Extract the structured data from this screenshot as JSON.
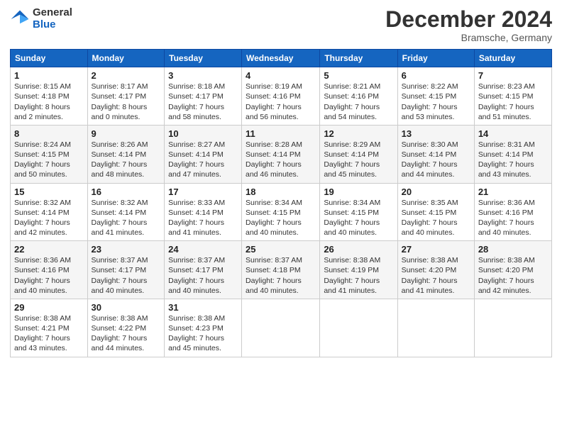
{
  "header": {
    "logo_general": "General",
    "logo_blue": "Blue",
    "main_title": "December 2024",
    "subtitle": "Bramsche, Germany"
  },
  "calendar": {
    "days_of_week": [
      "Sunday",
      "Monday",
      "Tuesday",
      "Wednesday",
      "Thursday",
      "Friday",
      "Saturday"
    ],
    "weeks": [
      [
        {
          "day": "1",
          "info": "Sunrise: 8:15 AM\nSunset: 4:18 PM\nDaylight: 8 hours\nand 2 minutes."
        },
        {
          "day": "2",
          "info": "Sunrise: 8:17 AM\nSunset: 4:17 PM\nDaylight: 8 hours\nand 0 minutes."
        },
        {
          "day": "3",
          "info": "Sunrise: 8:18 AM\nSunset: 4:17 PM\nDaylight: 7 hours\nand 58 minutes."
        },
        {
          "day": "4",
          "info": "Sunrise: 8:19 AM\nSunset: 4:16 PM\nDaylight: 7 hours\nand 56 minutes."
        },
        {
          "day": "5",
          "info": "Sunrise: 8:21 AM\nSunset: 4:16 PM\nDaylight: 7 hours\nand 54 minutes."
        },
        {
          "day": "6",
          "info": "Sunrise: 8:22 AM\nSunset: 4:15 PM\nDaylight: 7 hours\nand 53 minutes."
        },
        {
          "day": "7",
          "info": "Sunrise: 8:23 AM\nSunset: 4:15 PM\nDaylight: 7 hours\nand 51 minutes."
        }
      ],
      [
        {
          "day": "8",
          "info": "Sunrise: 8:24 AM\nSunset: 4:15 PM\nDaylight: 7 hours\nand 50 minutes."
        },
        {
          "day": "9",
          "info": "Sunrise: 8:26 AM\nSunset: 4:14 PM\nDaylight: 7 hours\nand 48 minutes."
        },
        {
          "day": "10",
          "info": "Sunrise: 8:27 AM\nSunset: 4:14 PM\nDaylight: 7 hours\nand 47 minutes."
        },
        {
          "day": "11",
          "info": "Sunrise: 8:28 AM\nSunset: 4:14 PM\nDaylight: 7 hours\nand 46 minutes."
        },
        {
          "day": "12",
          "info": "Sunrise: 8:29 AM\nSunset: 4:14 PM\nDaylight: 7 hours\nand 45 minutes."
        },
        {
          "day": "13",
          "info": "Sunrise: 8:30 AM\nSunset: 4:14 PM\nDaylight: 7 hours\nand 44 minutes."
        },
        {
          "day": "14",
          "info": "Sunrise: 8:31 AM\nSunset: 4:14 PM\nDaylight: 7 hours\nand 43 minutes."
        }
      ],
      [
        {
          "day": "15",
          "info": "Sunrise: 8:32 AM\nSunset: 4:14 PM\nDaylight: 7 hours\nand 42 minutes."
        },
        {
          "day": "16",
          "info": "Sunrise: 8:32 AM\nSunset: 4:14 PM\nDaylight: 7 hours\nand 41 minutes."
        },
        {
          "day": "17",
          "info": "Sunrise: 8:33 AM\nSunset: 4:14 PM\nDaylight: 7 hours\nand 41 minutes."
        },
        {
          "day": "18",
          "info": "Sunrise: 8:34 AM\nSunset: 4:15 PM\nDaylight: 7 hours\nand 40 minutes."
        },
        {
          "day": "19",
          "info": "Sunrise: 8:34 AM\nSunset: 4:15 PM\nDaylight: 7 hours\nand 40 minutes."
        },
        {
          "day": "20",
          "info": "Sunrise: 8:35 AM\nSunset: 4:15 PM\nDaylight: 7 hours\nand 40 minutes."
        },
        {
          "day": "21",
          "info": "Sunrise: 8:36 AM\nSunset: 4:16 PM\nDaylight: 7 hours\nand 40 minutes."
        }
      ],
      [
        {
          "day": "22",
          "info": "Sunrise: 8:36 AM\nSunset: 4:16 PM\nDaylight: 7 hours\nand 40 minutes."
        },
        {
          "day": "23",
          "info": "Sunrise: 8:37 AM\nSunset: 4:17 PM\nDaylight: 7 hours\nand 40 minutes."
        },
        {
          "day": "24",
          "info": "Sunrise: 8:37 AM\nSunset: 4:17 PM\nDaylight: 7 hours\nand 40 minutes."
        },
        {
          "day": "25",
          "info": "Sunrise: 8:37 AM\nSunset: 4:18 PM\nDaylight: 7 hours\nand 40 minutes."
        },
        {
          "day": "26",
          "info": "Sunrise: 8:38 AM\nSunset: 4:19 PM\nDaylight: 7 hours\nand 41 minutes."
        },
        {
          "day": "27",
          "info": "Sunrise: 8:38 AM\nSunset: 4:20 PM\nDaylight: 7 hours\nand 41 minutes."
        },
        {
          "day": "28",
          "info": "Sunrise: 8:38 AM\nSunset: 4:20 PM\nDaylight: 7 hours\nand 42 minutes."
        }
      ],
      [
        {
          "day": "29",
          "info": "Sunrise: 8:38 AM\nSunset: 4:21 PM\nDaylight: 7 hours\nand 43 minutes."
        },
        {
          "day": "30",
          "info": "Sunrise: 8:38 AM\nSunset: 4:22 PM\nDaylight: 7 hours\nand 44 minutes."
        },
        {
          "day": "31",
          "info": "Sunrise: 8:38 AM\nSunset: 4:23 PM\nDaylight: 7 hours\nand 45 minutes."
        },
        {
          "day": "",
          "info": ""
        },
        {
          "day": "",
          "info": ""
        },
        {
          "day": "",
          "info": ""
        },
        {
          "day": "",
          "info": ""
        }
      ]
    ]
  }
}
